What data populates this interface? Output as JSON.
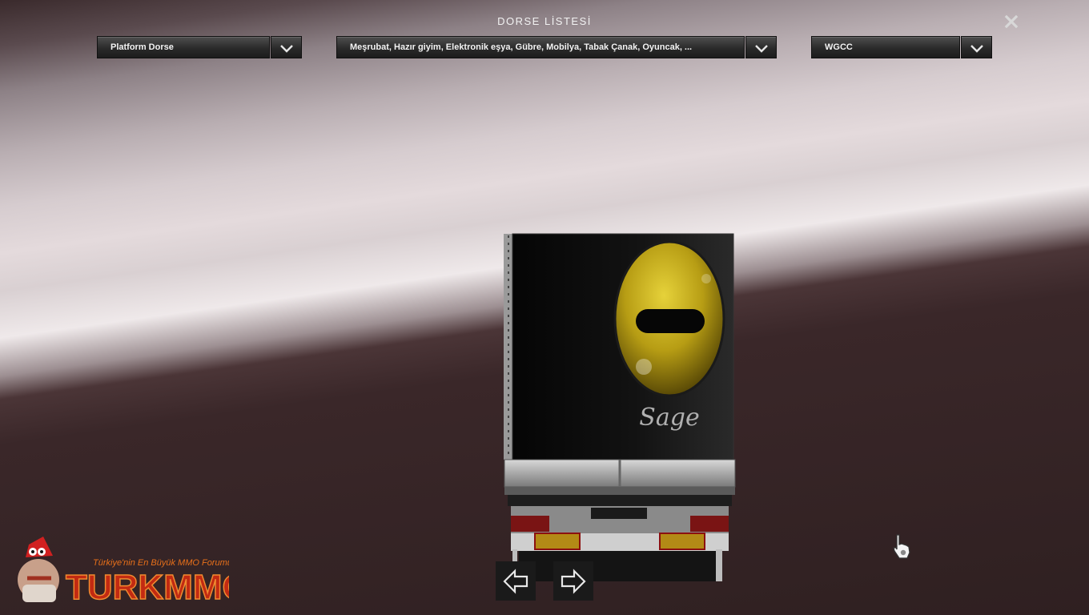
{
  "header": {
    "title": "DORSE LİSTESİ"
  },
  "dropdowns": {
    "trailer_type": "Platform Dorse",
    "cargo": "Meşrubat, Hazır giyim, Elektronik eşya, Gübre, Mobilya, Tabak Çanak, Oyuncak, ...",
    "company": "WGCC"
  },
  "trailer_art": {
    "signature": "Sage",
    "logo_color": "#c9b11c"
  },
  "watermark": {
    "tagline": "Türkiye'nin En Büyük MMO Forumu",
    "brand": "TURKMMO"
  },
  "icons": {
    "close": "close-icon",
    "dropdown": "chevron-down-icon",
    "prev": "arrow-left-icon",
    "next": "arrow-right-icon",
    "cursor": "hand-cursor-icon"
  },
  "colors": {
    "header_text": "#f2f2f2",
    "dropdown_bg": "#2a2a2a",
    "nav_bg": "#1a1a1a",
    "brand_orange": "#e8701a"
  }
}
